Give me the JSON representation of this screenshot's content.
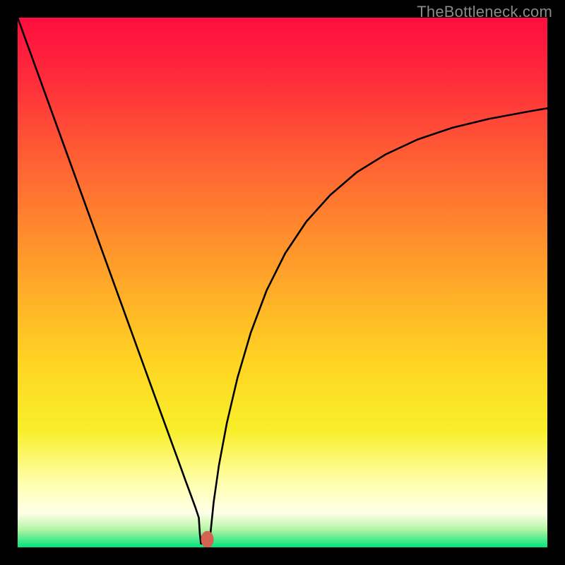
{
  "watermark": "TheBottleneck.com",
  "chart_data": {
    "type": "line",
    "title": "",
    "xlabel": "",
    "ylabel": "",
    "xlim": [
      0,
      100
    ],
    "ylim": [
      0,
      100
    ],
    "background": {
      "type": "vertical-gradient",
      "stops": [
        {
          "pos": 0.0,
          "color": "#ff0d3f"
        },
        {
          "pos": 0.12,
          "color": "#ff2d3b"
        },
        {
          "pos": 0.25,
          "color": "#ff5a34"
        },
        {
          "pos": 0.38,
          "color": "#ff832e"
        },
        {
          "pos": 0.52,
          "color": "#ffae28"
        },
        {
          "pos": 0.65,
          "color": "#ffd422"
        },
        {
          "pos": 0.78,
          "color": "#f8ef2a"
        },
        {
          "pos": 0.88,
          "color": "#ffffb0"
        },
        {
          "pos": 0.935,
          "color": "#ffffe8"
        },
        {
          "pos": 0.965,
          "color": "#b8f5a8"
        },
        {
          "pos": 1.0,
          "color": "#00e47a"
        }
      ]
    },
    "series": [
      {
        "name": "bottleneck-curve",
        "color": "#000000",
        "width": 2.6,
        "x": [
          0.0,
          2.5,
          5.0,
          7.5,
          10.0,
          12.5,
          15.0,
          17.5,
          20.0,
          22.5,
          25.0,
          27.0,
          29.0,
          30.5,
          31.8,
          32.8,
          33.6,
          34.2,
          34.4,
          34.6,
          36.2,
          37.0,
          38.0,
          39.5,
          41.5,
          44.0,
          47.0,
          50.5,
          54.5,
          59.0,
          64.0,
          69.5,
          75.5,
          82.0,
          89.0,
          96.0,
          100.0
        ],
        "y": [
          100.0,
          93.1,
          86.2,
          79.3,
          72.4,
          65.5,
          58.6,
          51.7,
          44.8,
          37.9,
          31.0,
          25.5,
          20.0,
          15.9,
          12.3,
          9.6,
          7.4,
          5.6,
          2.5,
          0.7,
          0.7,
          8.5,
          15.5,
          23.5,
          32.0,
          40.5,
          48.5,
          55.5,
          61.5,
          66.5,
          70.8,
          74.2,
          77.0,
          79.2,
          80.9,
          82.2,
          82.9
        ]
      }
    ],
    "marker": {
      "x": 35.8,
      "y": 1.5,
      "rx": 1.2,
      "ry": 1.6,
      "color": "#d4634f"
    }
  }
}
